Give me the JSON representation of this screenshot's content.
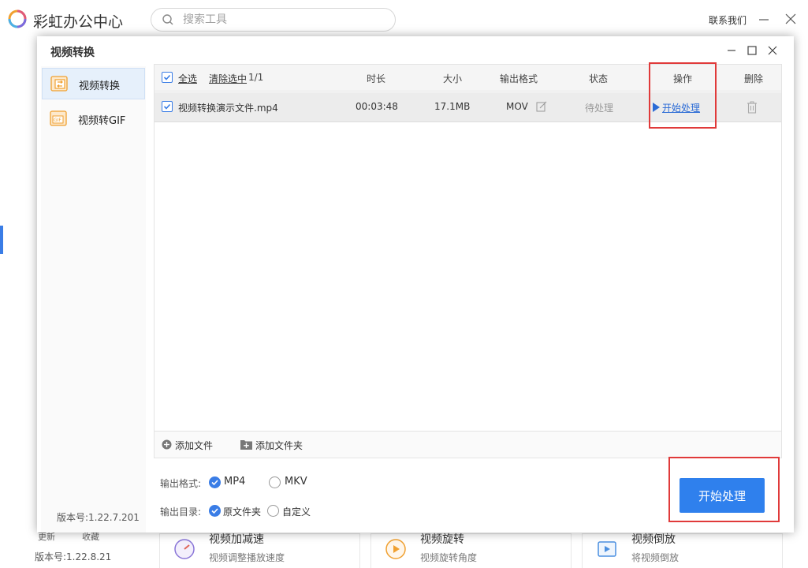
{
  "app": {
    "title": "彩虹办公中心",
    "search_placeholder": "搜索工具",
    "contact": "联系我们",
    "bottom": {
      "update": "更新",
      "favorites": "收藏",
      "version": "版本号:1.22.8.21",
      "cards": [
        {
          "title": "视频加减速",
          "subtitle": "视频调整播放速度",
          "icon": "speed-gauge-icon"
        },
        {
          "title": "视频旋转",
          "subtitle": "视频旋转角度",
          "icon": "rotate-play-icon"
        },
        {
          "title": "视频倒放",
          "subtitle": "将视频倒放",
          "icon": "reverse-play-icon"
        }
      ]
    }
  },
  "dialog": {
    "title": "视频转换",
    "sidebar": [
      {
        "label": "视频转换",
        "icon": "video-convert-icon",
        "active": true
      },
      {
        "label": "视频转GIF",
        "icon": "gif-icon",
        "active": false
      }
    ],
    "version": "版本号:1.22.7.201",
    "table": {
      "select_all": "全选",
      "clear_selected": "清除选中",
      "count": "1/1",
      "headers": {
        "duration": "时长",
        "size": "大小",
        "format": "输出格式",
        "status": "状态",
        "action": "操作",
        "delete": "删除"
      },
      "rows": [
        {
          "checked": true,
          "name": "视频转换演示文件.mp4",
          "duration": "00:03:48",
          "size": "17.1MB",
          "format": "MOV",
          "status": "待处理",
          "action": "开始处理"
        }
      ],
      "add_file": "添加文件",
      "add_folder": "添加文件夹"
    },
    "output_format": {
      "label": "输出格式:",
      "options": [
        "MP4",
        "MKV"
      ],
      "selected": "MP4"
    },
    "output_dir": {
      "label": "输出目录:",
      "options": [
        "原文件夹",
        "自定义"
      ],
      "selected": "原文件夹"
    },
    "start_button": "开始处理"
  },
  "colors": {
    "accent": "#2f80ed",
    "highlight": "#e03a3a",
    "link": "#2b6bd6"
  }
}
